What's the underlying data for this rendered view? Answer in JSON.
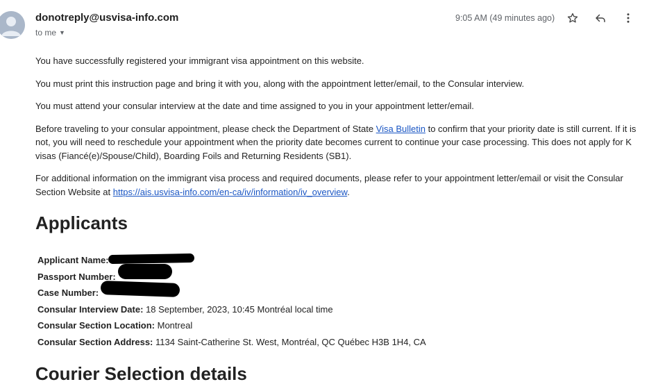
{
  "header": {
    "sender": "donotreply@usvisa-info.com",
    "recipient_line": "to me",
    "timestamp": "9:05 AM (49 minutes ago)"
  },
  "icons": {
    "star": "star-icon",
    "reply": "reply-icon",
    "more": "more-vertical-icon",
    "avatar": "default-avatar-icon"
  },
  "colors": {
    "link": "#1a56c4",
    "avatar_bg": "#aab7c9",
    "text": "#222222",
    "muted": "#5f6368"
  },
  "body": {
    "p1": "You have successfully registered your immigrant visa appointment on this website.",
    "p2": "You must print this instruction page and bring it with you, along with the appointment letter/email, to the Consular interview.",
    "p3": "You must attend your consular interview at the date and time assigned to you in your appointment letter/email.",
    "p4_before": "Before traveling to your consular appointment, please check the Department of State ",
    "p4_link": "Visa Bulletin",
    "p4_after": " to confirm that your priority date is still current. If it is not, you will need to reschedule your appointment when the priority date becomes current to continue your case processing. This does not apply for K visas (Fiancé(e)/Spouse/Child), Boarding Foils and Returning Residents (SB1).",
    "p5_before": "For additional information on the immigrant visa process and required documents, please refer to your appointment letter/email or visit the Consular Section Website at ",
    "p5_link": "https://ais.usvisa-info.com/en-ca/iv/information/iv_overview",
    "p5_after": "."
  },
  "applicants": {
    "title": "Applicants",
    "fields": [
      {
        "label": "Applicant Name:",
        "value": ""
      },
      {
        "label": "Passport Number:",
        "value": ""
      },
      {
        "label": "Case Number:",
        "value": ""
      },
      {
        "label": "Consular Interview Date:",
        "value": " 18 September, 2023, 10:45 Montréal local time"
      },
      {
        "label": "Consular Section Location:",
        "value": " Montreal"
      },
      {
        "label": "Consular Section Address:",
        "value": " 1134 Saint-Catherine St. West, Montréal, QC Québec H3B 1H4, CA"
      }
    ]
  },
  "courier": {
    "title": "Courier Selection details"
  }
}
